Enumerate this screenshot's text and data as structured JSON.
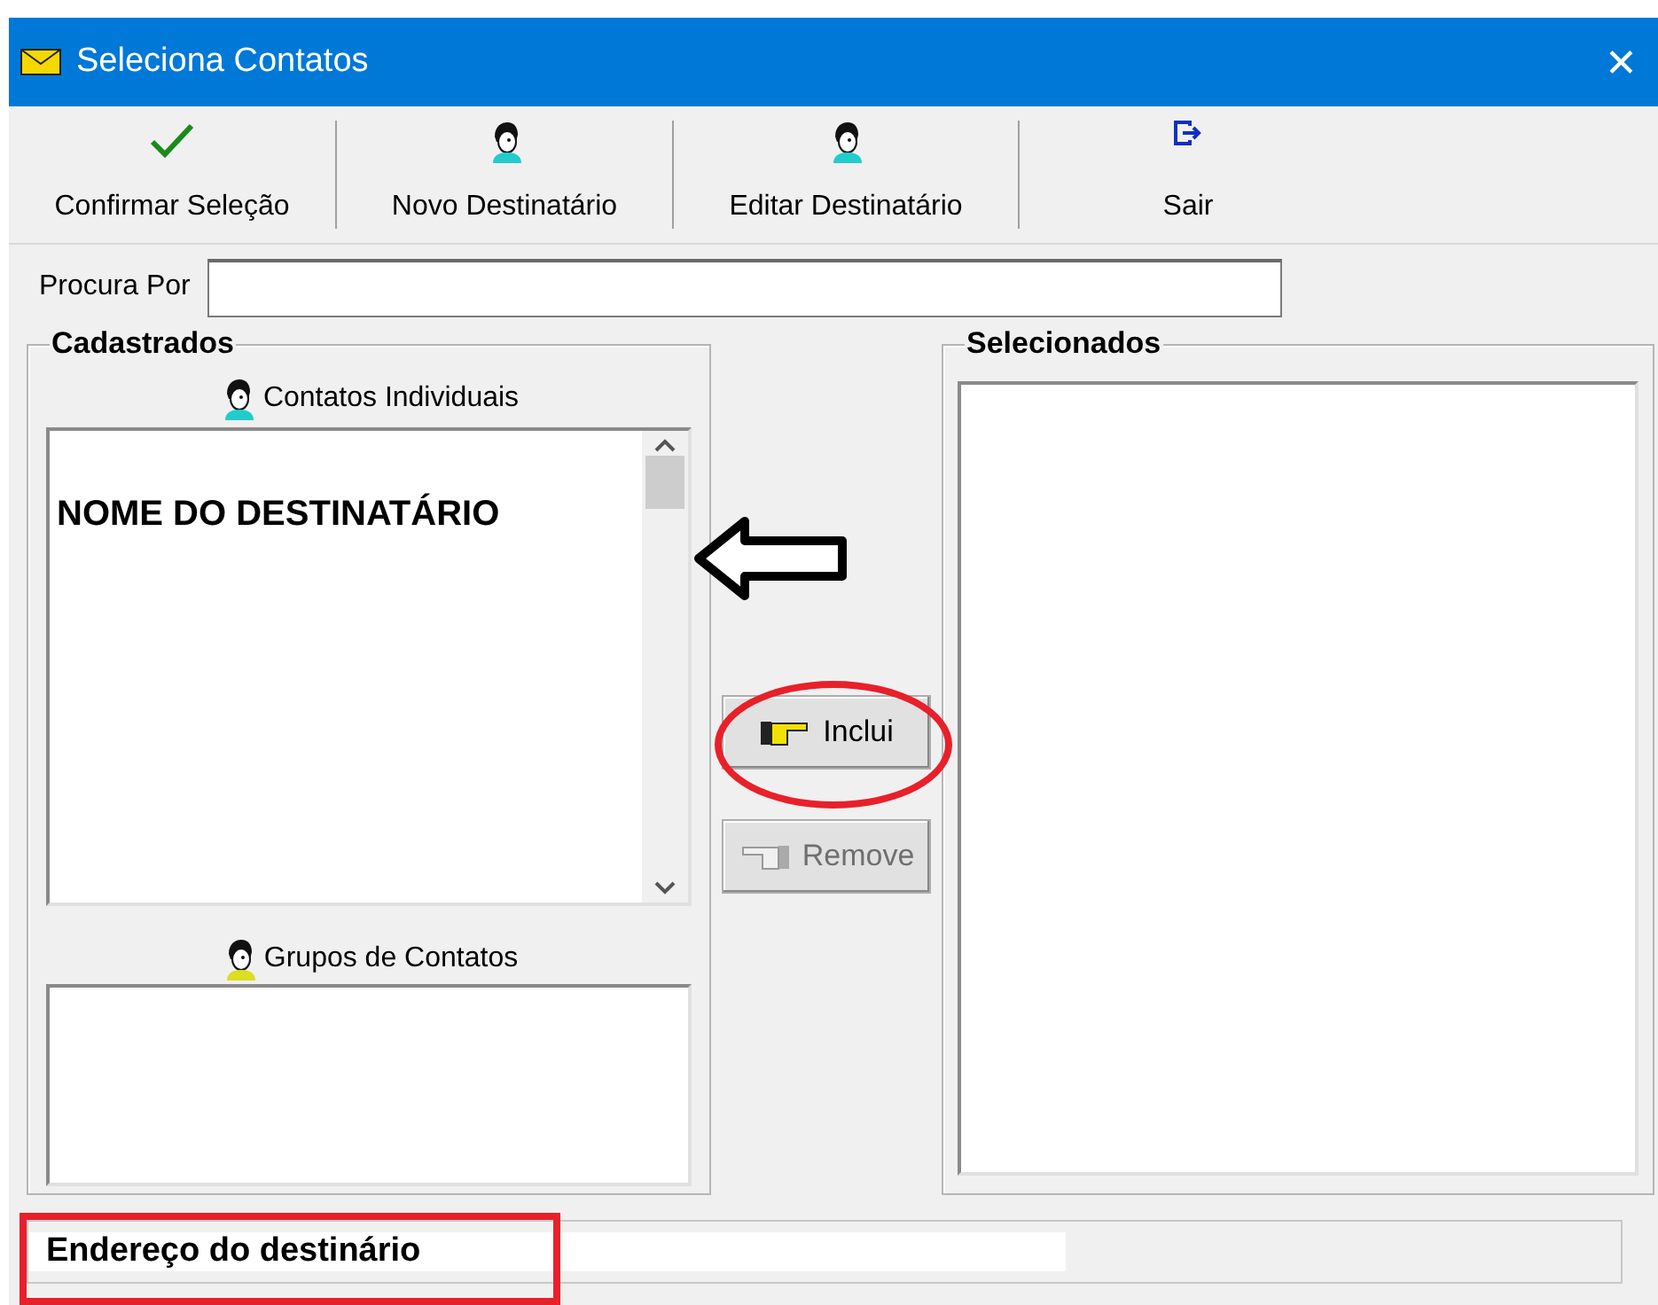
{
  "window": {
    "title": "Seleciona Contatos",
    "close": "✕"
  },
  "toolbar": [
    {
      "kind": "check",
      "label": "Confirmar Seleção"
    },
    {
      "kind": "person",
      "label": "Novo Destinatário"
    },
    {
      "kind": "person",
      "label": "Editar Destinatário"
    },
    {
      "kind": "exit",
      "label": "Sair"
    }
  ],
  "search": {
    "label": "Procura Por"
  },
  "registered": {
    "title": "Cadastrados",
    "individuals": {
      "label": "Contatos Individuais",
      "items": [
        "NOME DO DESTINATÁRIO"
      ]
    },
    "groups": {
      "label": "Grupos de Contatos"
    }
  },
  "actions": [
    {
      "kind": "include",
      "label": "Inclui",
      "disabled": false
    },
    {
      "kind": "remove",
      "label": "Remove",
      "disabled": true
    }
  ],
  "selected": {
    "title": "Selecionados"
  },
  "status_bar": {
    "text": "Endereço do destinário"
  }
}
